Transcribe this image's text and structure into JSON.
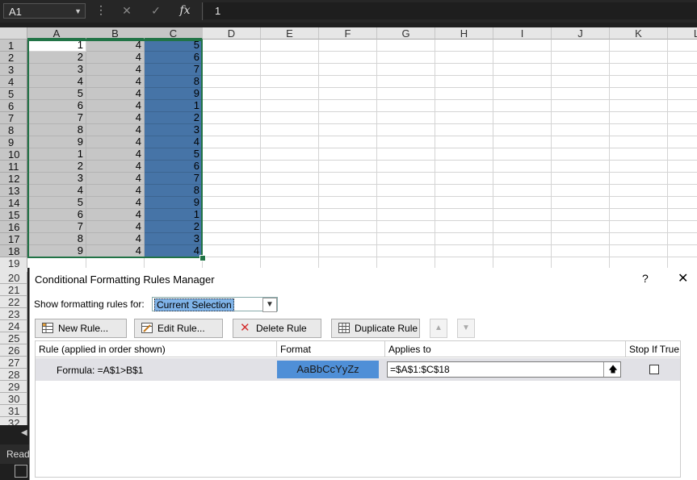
{
  "formula_bar": {
    "name_box": "A1",
    "cancel_icon": "cancel-x-icon",
    "enter_icon": "check-icon",
    "fx_label": "fx",
    "value": "1"
  },
  "columns": [
    "A",
    "B",
    "C",
    "D",
    "E",
    "F",
    "G",
    "H",
    "I",
    "J",
    "K",
    "L"
  ],
  "rows": [
    "1",
    "2",
    "3",
    "4",
    "5",
    "6",
    "7",
    "8",
    "9",
    "10",
    "11",
    "12",
    "13",
    "14",
    "15",
    "16",
    "17",
    "18",
    "19",
    "20",
    "21",
    "22",
    "23",
    "24",
    "25",
    "26",
    "27",
    "28",
    "29",
    "30",
    "31",
    "32"
  ],
  "cells": {
    "A": [
      "1",
      "2",
      "3",
      "4",
      "5",
      "6",
      "7",
      "8",
      "9",
      "1",
      "2",
      "3",
      "4",
      "5",
      "6",
      "7",
      "8",
      "9"
    ],
    "B": [
      "4",
      "4",
      "4",
      "4",
      "4",
      "4",
      "4",
      "4",
      "4",
      "4",
      "4",
      "4",
      "4",
      "4",
      "4",
      "4",
      "4",
      "4"
    ],
    "C": [
      "5",
      "6",
      "7",
      "8",
      "9",
      "1",
      "2",
      "3",
      "4",
      "5",
      "6",
      "7",
      "8",
      "9",
      "1",
      "2",
      "3",
      "4"
    ]
  },
  "colors": {
    "grey_fill": "#c6c6c6",
    "blue_fill": "#4674a7",
    "selection": "#217346",
    "format_preview": "#4f8fd7"
  },
  "status": {
    "text": "Read"
  },
  "dialog": {
    "title": "Conditional Formatting Rules Manager",
    "help": "?",
    "close": "✕",
    "show_label": "Show formatting rules for:",
    "show_value": "Current Selection",
    "buttons": {
      "new_rule": "New Rule...",
      "edit_rule": "Edit Rule...",
      "delete_rule": "Delete Rule",
      "duplicate_rule": "Duplicate Rule"
    },
    "headers": {
      "rule": "Rule (applied in order shown)",
      "format": "Format",
      "applies_to": "Applies to",
      "stop_if_true": "Stop If True"
    },
    "rule": {
      "label": "Formula: =A$1>B$1",
      "preview": "AaBbCcYyZz",
      "applies_to": "=$A$1:$C$18"
    }
  }
}
